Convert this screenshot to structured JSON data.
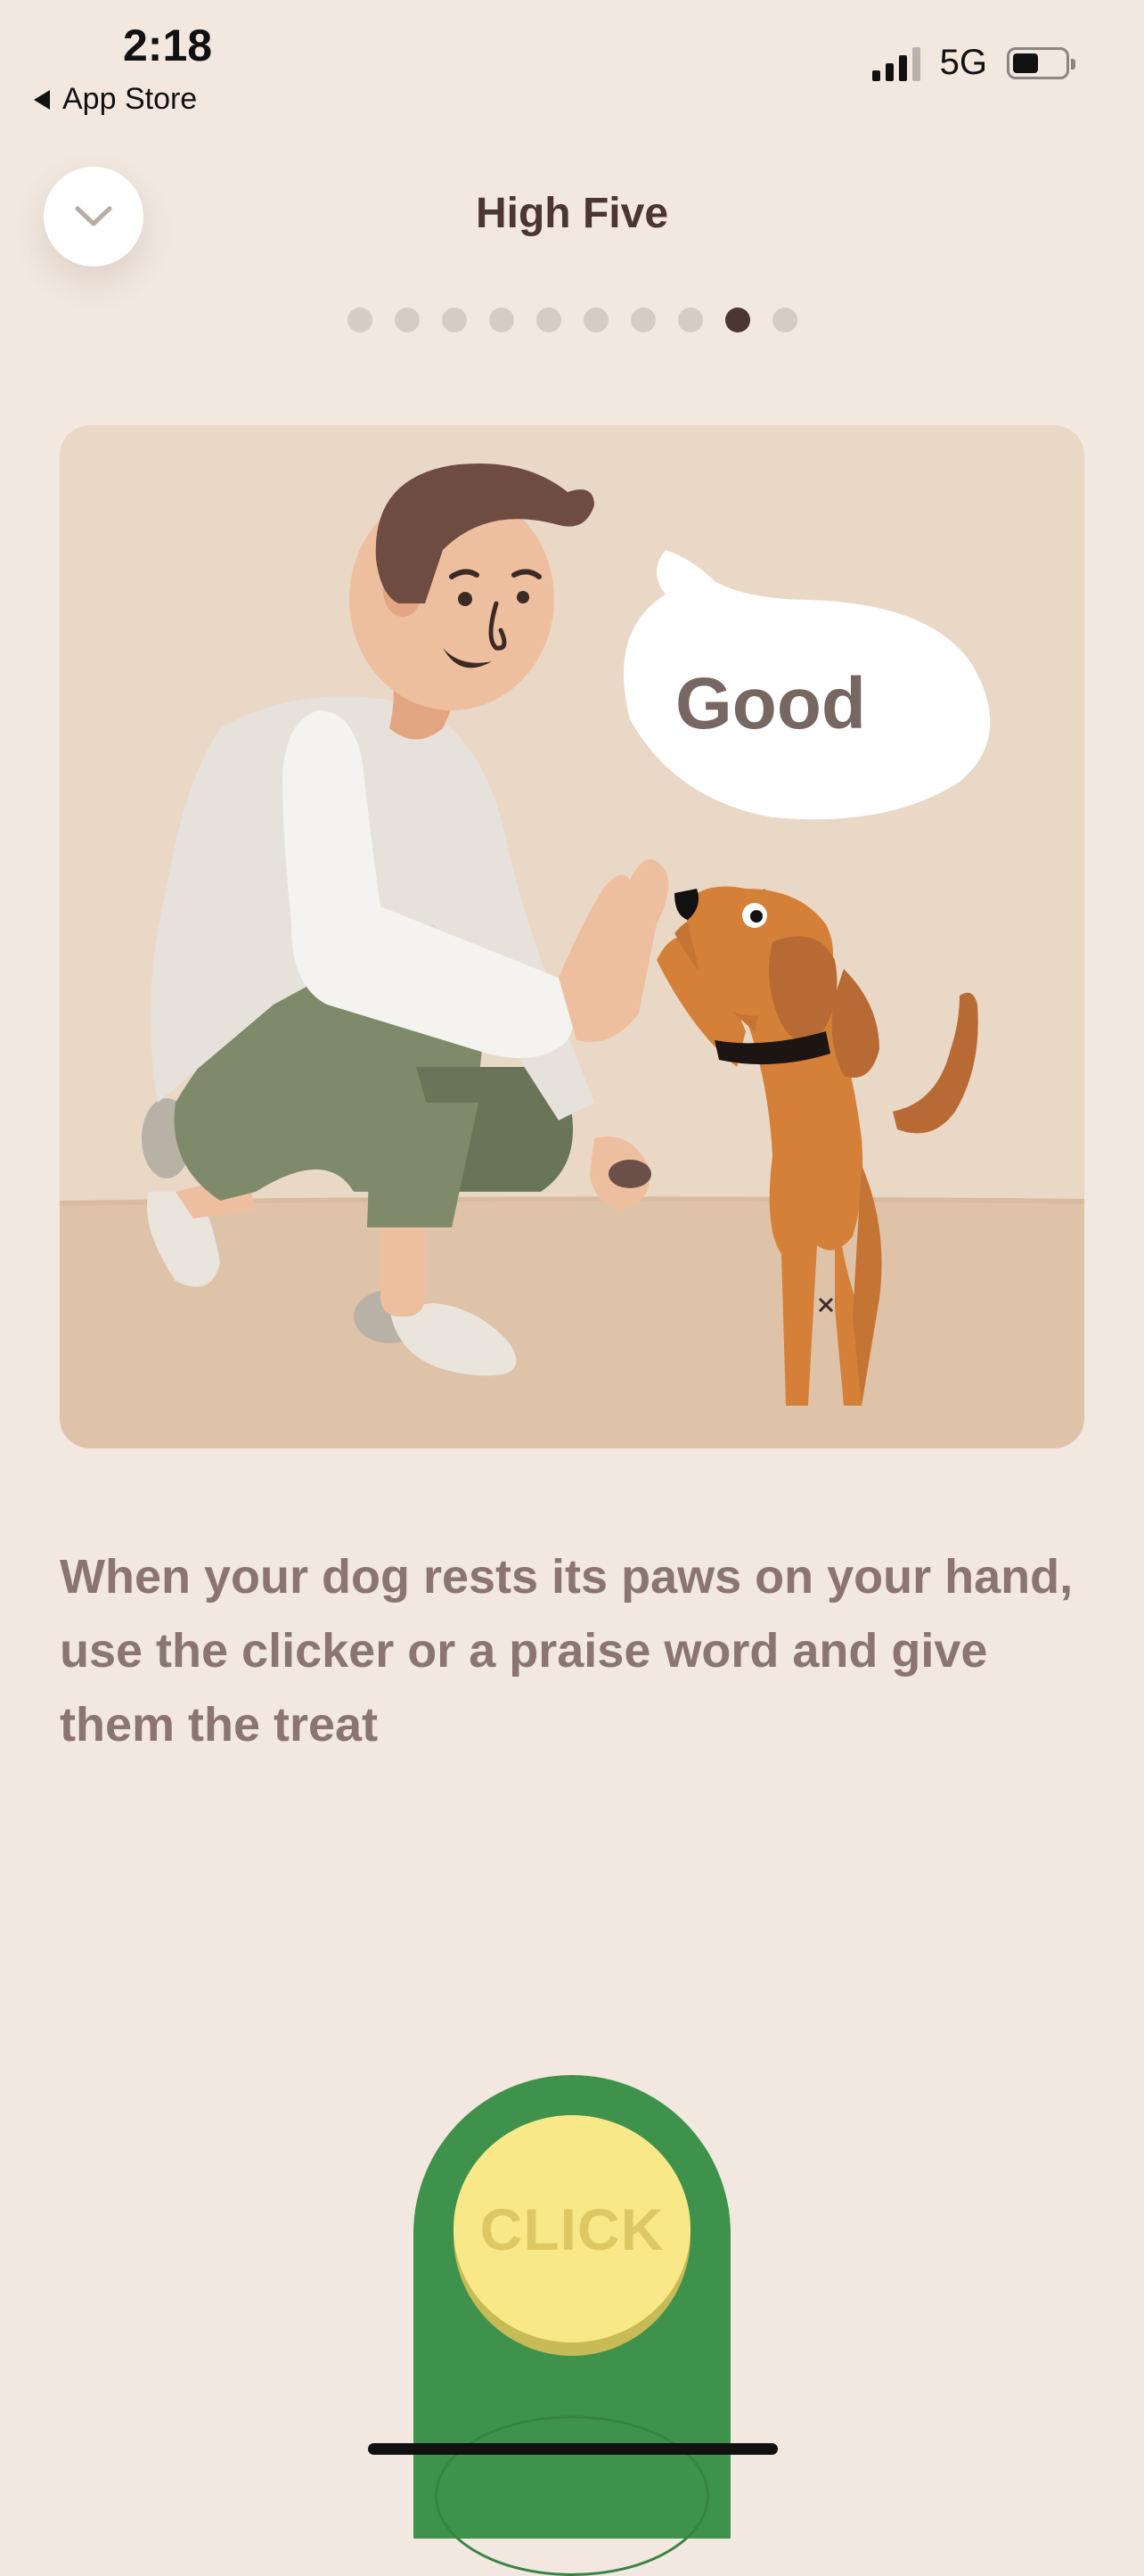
{
  "status_bar": {
    "time": "2:18",
    "back_label": "App Store",
    "network": "5G"
  },
  "header": {
    "title": "High Five",
    "collapse_icon": "chevron-down-icon",
    "pagination": {
      "total": 10,
      "current": 9
    }
  },
  "illustration": {
    "speech_bubble_text": "Good"
  },
  "description": "When your dog rests its paws on your hand, use the clicker or a praise word and give them the treat",
  "clicker": {
    "label": "CLICK"
  },
  "colors": {
    "background": "#f2e8e0",
    "title": "#4b3631",
    "body_text": "#8a7571",
    "clicker_green": "#3f924c",
    "clicker_button": "#f8e887"
  }
}
